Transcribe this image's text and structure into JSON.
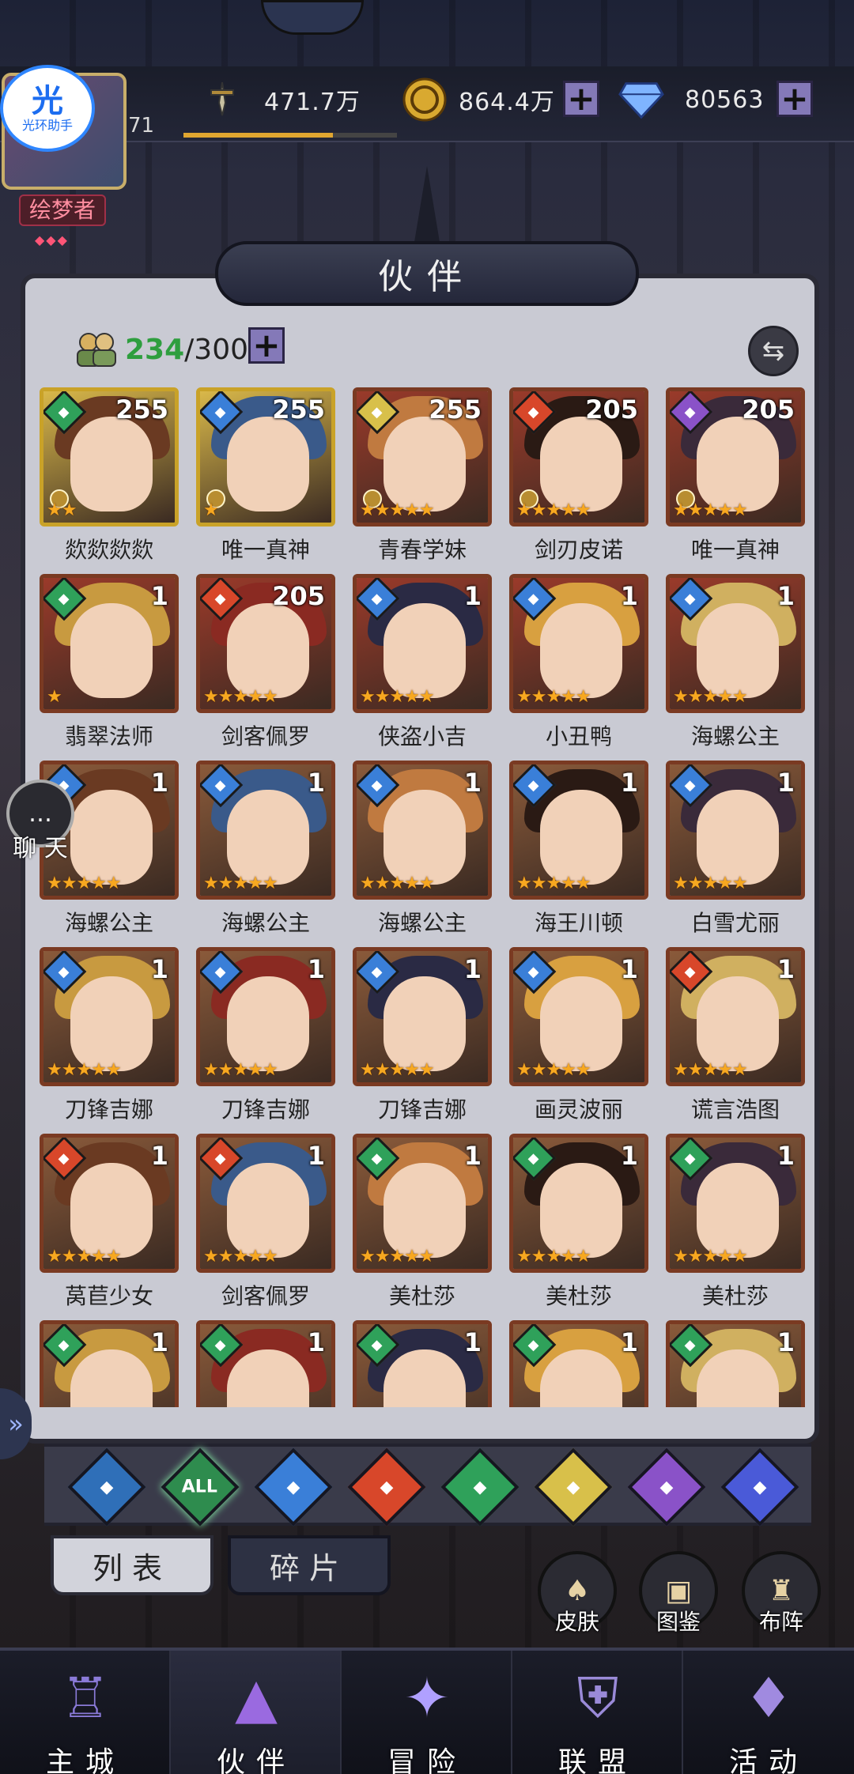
{
  "player": {
    "level": "71",
    "title_badge": "绘梦者",
    "xp_fraction": 0.7,
    "logo_text": "光",
    "logo_subtext": "光环助手"
  },
  "resources": {
    "power": "471.7万",
    "gold": "864.4万",
    "diamonds": "80563"
  },
  "screen_title": "伙伴",
  "roster": {
    "current": "234",
    "separator": "/",
    "capacity": "300"
  },
  "companions": [
    {
      "name": "欻欻欻欻",
      "level": "255",
      "element": "nature",
      "stars": 2,
      "frame": "gold",
      "crown": true
    },
    {
      "name": "唯一真神",
      "level": "255",
      "element": "water",
      "stars": 1,
      "frame": "gold",
      "crown": true
    },
    {
      "name": "青春学妹",
      "level": "255",
      "element": "light",
      "stars": 5,
      "frame": "red",
      "crown": true
    },
    {
      "name": "剑刃皮诺",
      "level": "205",
      "element": "fire",
      "stars": 5,
      "frame": "red",
      "crown": true
    },
    {
      "name": "唯一真神",
      "level": "205",
      "element": "dark",
      "stars": 5,
      "frame": "red",
      "crown": true
    },
    {
      "name": "翡翠法师",
      "level": "1",
      "element": "nature",
      "stars": 1,
      "frame": "red",
      "crown": false
    },
    {
      "name": "剑客佩罗",
      "level": "205",
      "element": "fire",
      "stars": 5,
      "frame": "red",
      "crown": false
    },
    {
      "name": "侠盗小吉",
      "level": "1",
      "element": "water",
      "stars": 5,
      "frame": "red",
      "crown": false
    },
    {
      "name": "小丑鸭",
      "level": "1",
      "element": "water",
      "stars": 5,
      "frame": "red",
      "crown": false
    },
    {
      "name": "海螺公主",
      "level": "1",
      "element": "water",
      "stars": 5,
      "frame": "red",
      "crown": false
    },
    {
      "name": "海螺公主",
      "level": "1",
      "element": "water",
      "stars": 5,
      "frame": "brown",
      "crown": false
    },
    {
      "name": "海螺公主",
      "level": "1",
      "element": "water",
      "stars": 5,
      "frame": "brown",
      "crown": false
    },
    {
      "name": "海螺公主",
      "level": "1",
      "element": "water",
      "stars": 5,
      "frame": "brown",
      "crown": false
    },
    {
      "name": "海王川顿",
      "level": "1",
      "element": "water",
      "stars": 5,
      "frame": "brown",
      "crown": false
    },
    {
      "name": "白雪尤丽",
      "level": "1",
      "element": "water",
      "stars": 5,
      "frame": "brown",
      "crown": false
    },
    {
      "name": "刀锋吉娜",
      "level": "1",
      "element": "water",
      "stars": 5,
      "frame": "brown",
      "crown": false
    },
    {
      "name": "刀锋吉娜",
      "level": "1",
      "element": "water",
      "stars": 5,
      "frame": "brown",
      "crown": false
    },
    {
      "name": "刀锋吉娜",
      "level": "1",
      "element": "water",
      "stars": 5,
      "frame": "brown",
      "crown": false
    },
    {
      "name": "画灵波丽",
      "level": "1",
      "element": "water",
      "stars": 5,
      "frame": "brown",
      "crown": false
    },
    {
      "name": "谎言浩图",
      "level": "1",
      "element": "fire",
      "stars": 5,
      "frame": "brown",
      "crown": false
    },
    {
      "name": "莴苣少女",
      "level": "1",
      "element": "fire",
      "stars": 5,
      "frame": "brown",
      "crown": false
    },
    {
      "name": "剑客佩罗",
      "level": "1",
      "element": "fire",
      "stars": 5,
      "frame": "brown",
      "crown": false
    },
    {
      "name": "美杜莎",
      "level": "1",
      "element": "nature",
      "stars": 5,
      "frame": "brown",
      "crown": false
    },
    {
      "name": "美杜莎",
      "level": "1",
      "element": "nature",
      "stars": 5,
      "frame": "brown",
      "crown": false
    },
    {
      "name": "美杜莎",
      "level": "1",
      "element": "nature",
      "stars": 5,
      "frame": "brown",
      "crown": false
    },
    {
      "name": "",
      "level": "1",
      "element": "nature",
      "stars": 0,
      "frame": "brown",
      "crown": false
    },
    {
      "name": "",
      "level": "1",
      "element": "nature",
      "stars": 0,
      "frame": "brown",
      "crown": false
    },
    {
      "name": "",
      "level": "1",
      "element": "nature",
      "stars": 0,
      "frame": "brown",
      "crown": false
    },
    {
      "name": "",
      "level": "1",
      "element": "nature",
      "stars": 0,
      "frame": "brown",
      "crown": false
    },
    {
      "name": "",
      "level": "1",
      "element": "nature",
      "stars": 0,
      "frame": "brown",
      "crown": false
    }
  ],
  "element_filters": [
    {
      "key": "up",
      "label": ""
    },
    {
      "key": "all",
      "label": "ALL"
    },
    {
      "key": "water",
      "label": ""
    },
    {
      "key": "fire",
      "label": ""
    },
    {
      "key": "nature",
      "label": ""
    },
    {
      "key": "light",
      "label": ""
    },
    {
      "key": "dark",
      "label": ""
    },
    {
      "key": "cosmic",
      "label": ""
    }
  ],
  "element_colors": {
    "water": "#3a7fd8",
    "fire": "#d8472a",
    "nature": "#2fa15a",
    "light": "#d8c04a",
    "dark": "#8a52c8",
    "cosmic": "#4a5ad8",
    "up": "#2f6fb8",
    "all": "#2e8c4e"
  },
  "sub_tabs": {
    "list": "列表",
    "fragments": "碎片"
  },
  "quick_actions": {
    "skins": "皮肤",
    "codex": "图鉴",
    "formation": "布阵"
  },
  "chat": {
    "label": "聊 天"
  },
  "bottom_nav": {
    "city": "主城",
    "companions": "伙伴",
    "adventure": "冒险",
    "alliance": "联盟",
    "events": "活动"
  },
  "icons": {
    "power": "sword-icon",
    "gold": "coin-icon",
    "diamonds": "diamond-icon"
  }
}
